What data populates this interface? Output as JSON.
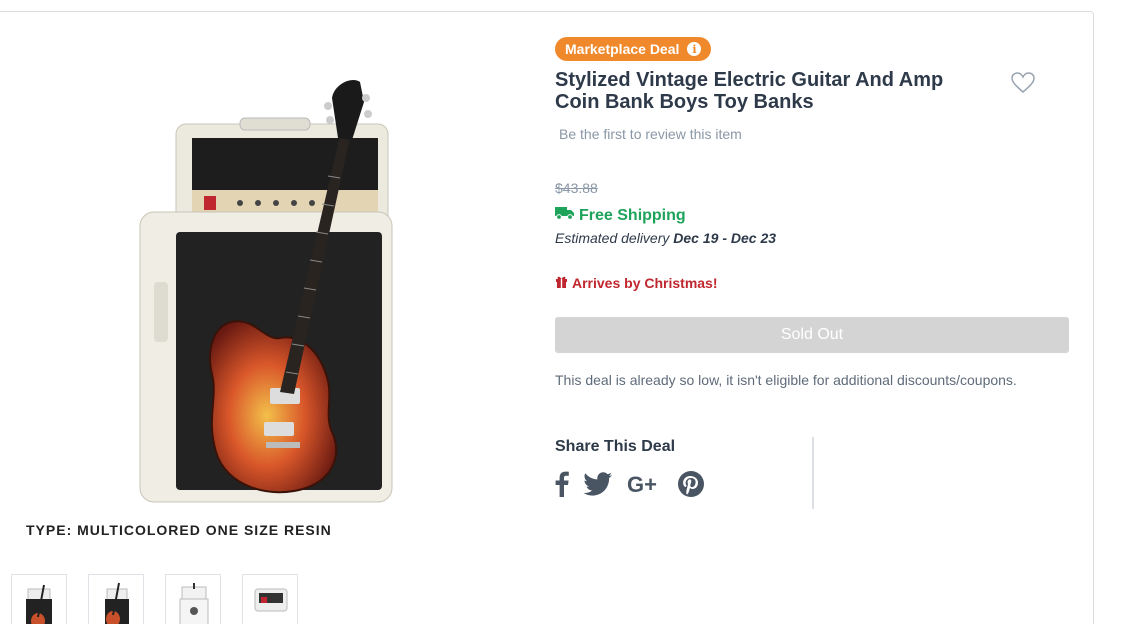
{
  "product": {
    "badge_label": "Marketplace Deal",
    "badge_info_glyph": "i",
    "title": "Stylized Vintage Electric Guitar And Amp Coin Bank Boys Toy Banks",
    "review_link": "Be the first to review this item",
    "old_price": "$43.88",
    "shipping_label": "Free Shipping",
    "delivery_prefix": "Estimated delivery",
    "delivery_range": "Dec 19 - Dec 23",
    "christmas_label": "Arrives by Christmas!",
    "sold_out_label": "Sold Out",
    "discount_note": "This deal is already so low, it isn't eligible for additional discounts/coupons.",
    "type_label": "TYPE: MULTICOLORED ONE SIZE RESIN"
  },
  "share": {
    "title": "Share This Deal",
    "icons": [
      "facebook-icon",
      "twitter-icon",
      "google-plus-icon",
      "pinterest-icon"
    ]
  },
  "thumbnails": [
    "guitar-amp-front",
    "guitar-amp-angle",
    "amp-back",
    "amp-head"
  ],
  "colors": {
    "badge": "#f0892b",
    "shipping": "#1ea35b",
    "christmas": "#c0262d",
    "sold_out_bg": "#d4d4d4",
    "title": "#2e3a4a"
  }
}
